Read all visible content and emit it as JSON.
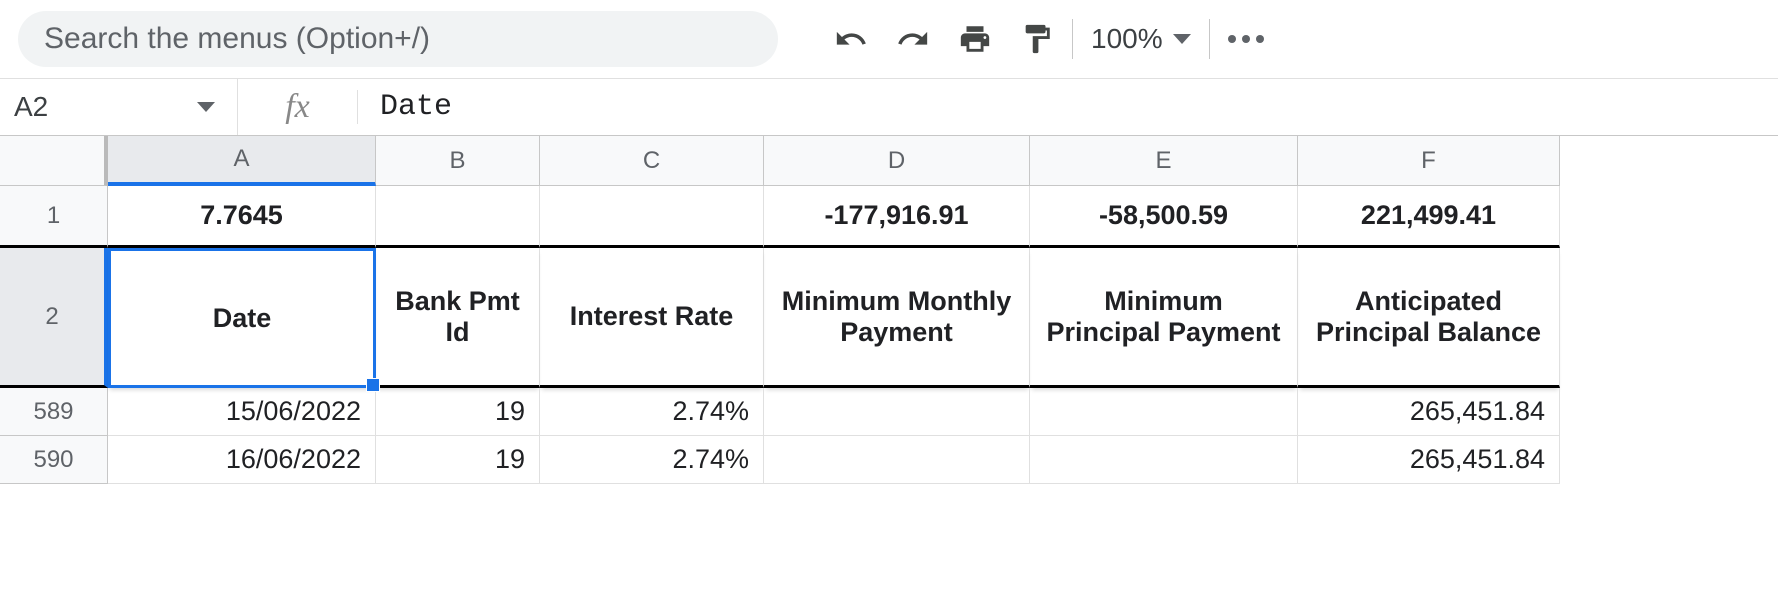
{
  "toolbar": {
    "search_placeholder": "Search the menus (Option+/)",
    "zoom_label": "100%"
  },
  "formula_bar": {
    "cell_ref": "A2",
    "formula": "Date"
  },
  "columns": [
    "A",
    "B",
    "C",
    "D",
    "E",
    "F"
  ],
  "rows": {
    "r1": {
      "num": "1",
      "A": "7.7645",
      "B": "",
      "C": "",
      "D": "-177,916.91",
      "E": "-58,500.59",
      "F": "221,499.41"
    },
    "r2": {
      "num": "2",
      "A": "Date",
      "B": "Bank Pmt Id",
      "C": "Interest Rate",
      "D": "Minimum Monthly Payment",
      "E": "Minimum Principal Payment",
      "F": "Anticipated Principal Balance"
    },
    "r589": {
      "num": "589",
      "A": "15/06/2022",
      "B": "19",
      "C": "2.74%",
      "D": "",
      "E": "",
      "F": "265,451.84"
    },
    "r590": {
      "num": "590",
      "A": "16/06/2022",
      "B": "19",
      "C": "2.74%",
      "D": "",
      "E": "",
      "F": "265,451.84"
    }
  }
}
